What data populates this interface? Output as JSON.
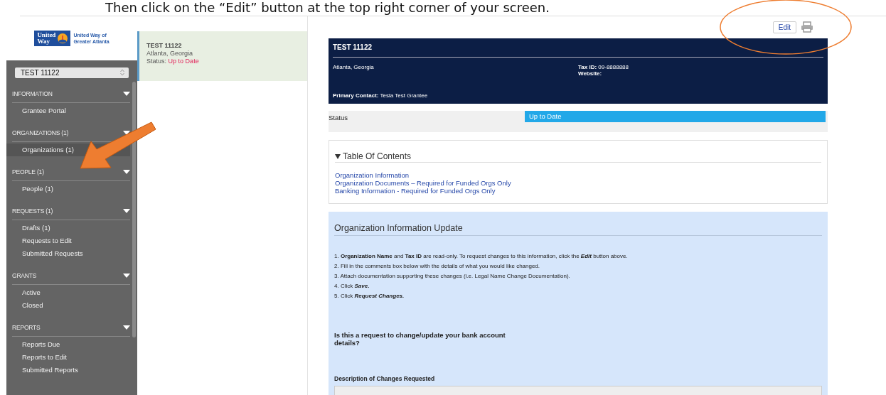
{
  "caption": "Then click on the “Edit” button at the top right corner of your screen.",
  "logo": {
    "mark_lines": [
      "United",
      "Way"
    ],
    "name_lines": [
      "United Way of",
      "Greater Atlanta"
    ]
  },
  "org_select": {
    "value": "TEST 11122"
  },
  "sidebar": {
    "groups": [
      {
        "title": "INFORMATION",
        "expanded": true,
        "items": [
          {
            "label": "Grantee Portal",
            "selected": false
          }
        ]
      },
      {
        "title": "ORGANIZATIONS (1)",
        "expanded": true,
        "items": [
          {
            "label": "Organizations  (1)",
            "selected": true
          }
        ]
      },
      {
        "title": "PEOPLE (1)",
        "expanded": true,
        "items": [
          {
            "label": "People  (1)",
            "selected": false
          }
        ]
      },
      {
        "title": "REQUESTS (1)",
        "expanded": true,
        "items": [
          {
            "label": "Drafts  (1)",
            "selected": false
          },
          {
            "label": "Requests to Edit",
            "selected": false
          },
          {
            "label": "Submitted Requests",
            "selected": false
          }
        ]
      },
      {
        "title": "GRANTS",
        "expanded": true,
        "items": [
          {
            "label": "Active",
            "selected": false
          },
          {
            "label": "Closed",
            "selected": false
          }
        ]
      },
      {
        "title": "REPORTS",
        "expanded": true,
        "items": [
          {
            "label": "Reports Due",
            "selected": false
          },
          {
            "label": "Reports to Edit",
            "selected": false
          },
          {
            "label": "Submitted Reports",
            "selected": false
          }
        ]
      }
    ]
  },
  "record_card": {
    "name": "TEST 11122",
    "location": "Atlanta, Georgia",
    "status_label": "Status:",
    "status_value": "Up to Date"
  },
  "toolbar": {
    "edit_button": "Edit"
  },
  "header": {
    "name": "TEST 11122",
    "location": "Atlanta, Georgia",
    "tax_id_label": "Tax ID:",
    "tax_id": "09-8888888",
    "website_label": "Website:",
    "contact_label": "Primary Contact:",
    "contact": "Tesla Test Grantee"
  },
  "status": {
    "label": "Status",
    "value": "Up to Date"
  },
  "toc": {
    "title": "Table Of Contents",
    "expanded": true,
    "links": [
      "Organization Information",
      "Organization Documents – Required for Funded Orgs Only",
      "Banking Information - Required for Funded Orgs Only"
    ]
  },
  "update_panel": {
    "title": "Organization Information Update",
    "steps": [
      "1. **Organization Name** and **Tax ID** are read-only. To request changes to this information, click the *Edit* button above.",
      "2. Fill in the comments box below with the details of what you would like changed.",
      "3. Attach documentation supporting these changes (i.e. Legal Name Change Documentation).",
      "4. Click *Save.*",
      "5. Click *Request Changes.*"
    ],
    "question": "Is this a request to change/update your bank account details?",
    "description_label": "Description of Changes Requested"
  }
}
